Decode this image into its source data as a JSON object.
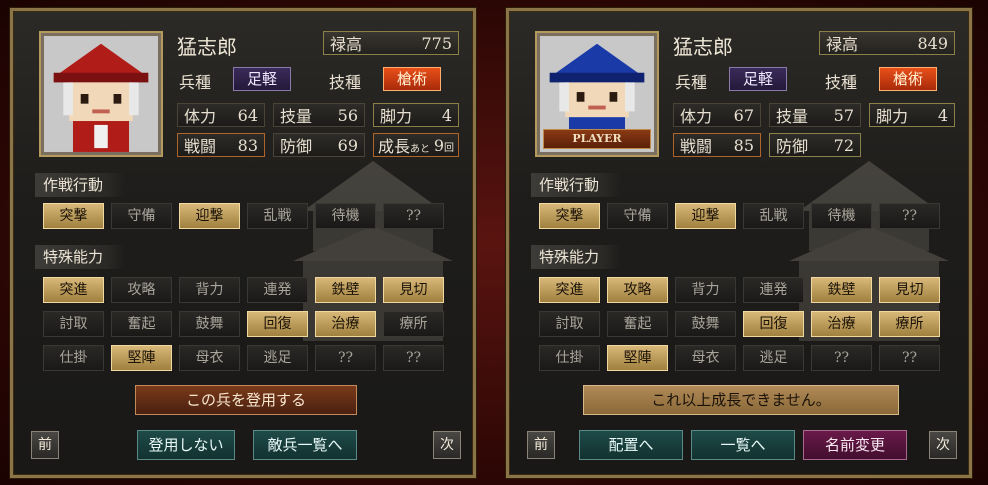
{
  "left": {
    "name": "猛志郎",
    "salary_label": "禄高",
    "salary_value": "775",
    "type_label": "兵種",
    "type_value": "足軽",
    "skill_label": "技種",
    "skill_value": "槍術",
    "stats": {
      "hp_label": "体力",
      "hp": "64",
      "tech_label": "技量",
      "tech": "56",
      "leg_label": "脚力",
      "leg": "4",
      "atk_label": "戦闘",
      "atk": "83",
      "def_label": "防御",
      "def": "69",
      "growth_label": "成長",
      "growth_small": "あと",
      "growth": "9",
      "growth_unit": "回"
    },
    "tactics_title": "作戦行動",
    "tactics": [
      "突撃",
      "守備",
      "迎撃",
      "乱戦",
      "待機",
      "??"
    ],
    "special_title": "特殊能力",
    "special": [
      "突進",
      "攻略",
      "背力",
      "連発",
      "鉄壁",
      "見切",
      "討取",
      "奮起",
      "鼓舞",
      "回復",
      "治療",
      "療所",
      "仕掛",
      "堅陣",
      "母衣",
      "逃足",
      "??",
      "??"
    ],
    "main_action": "この兵を登用する",
    "prev": "前",
    "next": "次",
    "btn1": "登用しない",
    "btn2": "敵兵一覧へ"
  },
  "right": {
    "name": "猛志郎",
    "player_tag": "PLAYER",
    "salary_label": "禄高",
    "salary_value": "849",
    "type_label": "兵種",
    "type_value": "足軽",
    "skill_label": "技種",
    "skill_value": "槍術",
    "stats": {
      "hp_label": "体力",
      "hp": "67",
      "tech_label": "技量",
      "tech": "57",
      "leg_label": "脚力",
      "leg": "4",
      "atk_label": "戦闘",
      "atk": "85",
      "def_label": "防御",
      "def": "72"
    },
    "tactics_title": "作戦行動",
    "tactics": [
      "突撃",
      "守備",
      "迎撃",
      "乱戦",
      "待機",
      "??"
    ],
    "special_title": "特殊能力",
    "special": [
      "突進",
      "攻略",
      "背力",
      "連発",
      "鉄壁",
      "見切",
      "討取",
      "奮起",
      "鼓舞",
      "回復",
      "治療",
      "療所",
      "仕掛",
      "堅陣",
      "母衣",
      "逃足",
      "??",
      "??"
    ],
    "main_action": "これ以上成長できません。",
    "prev": "前",
    "next": "次",
    "btn1": "配置へ",
    "btn2": "一覧へ",
    "btn3": "名前変更"
  },
  "states": {
    "left_tactics_on": [
      true,
      false,
      true,
      false,
      false,
      false
    ],
    "left_special_on": [
      true,
      false,
      false,
      false,
      true,
      true,
      false,
      false,
      false,
      true,
      true,
      false,
      false,
      true,
      false,
      false,
      false,
      false
    ],
    "right_tactics_on": [
      true,
      false,
      true,
      false,
      false,
      false
    ],
    "right_special_on": [
      true,
      true,
      false,
      false,
      true,
      true,
      false,
      false,
      false,
      true,
      true,
      true,
      false,
      true,
      false,
      false,
      false,
      false
    ]
  },
  "colors": {
    "left_hat": "#b01c18",
    "right_hat": "#1a3aa8",
    "accent_gold": "#d8b878"
  }
}
